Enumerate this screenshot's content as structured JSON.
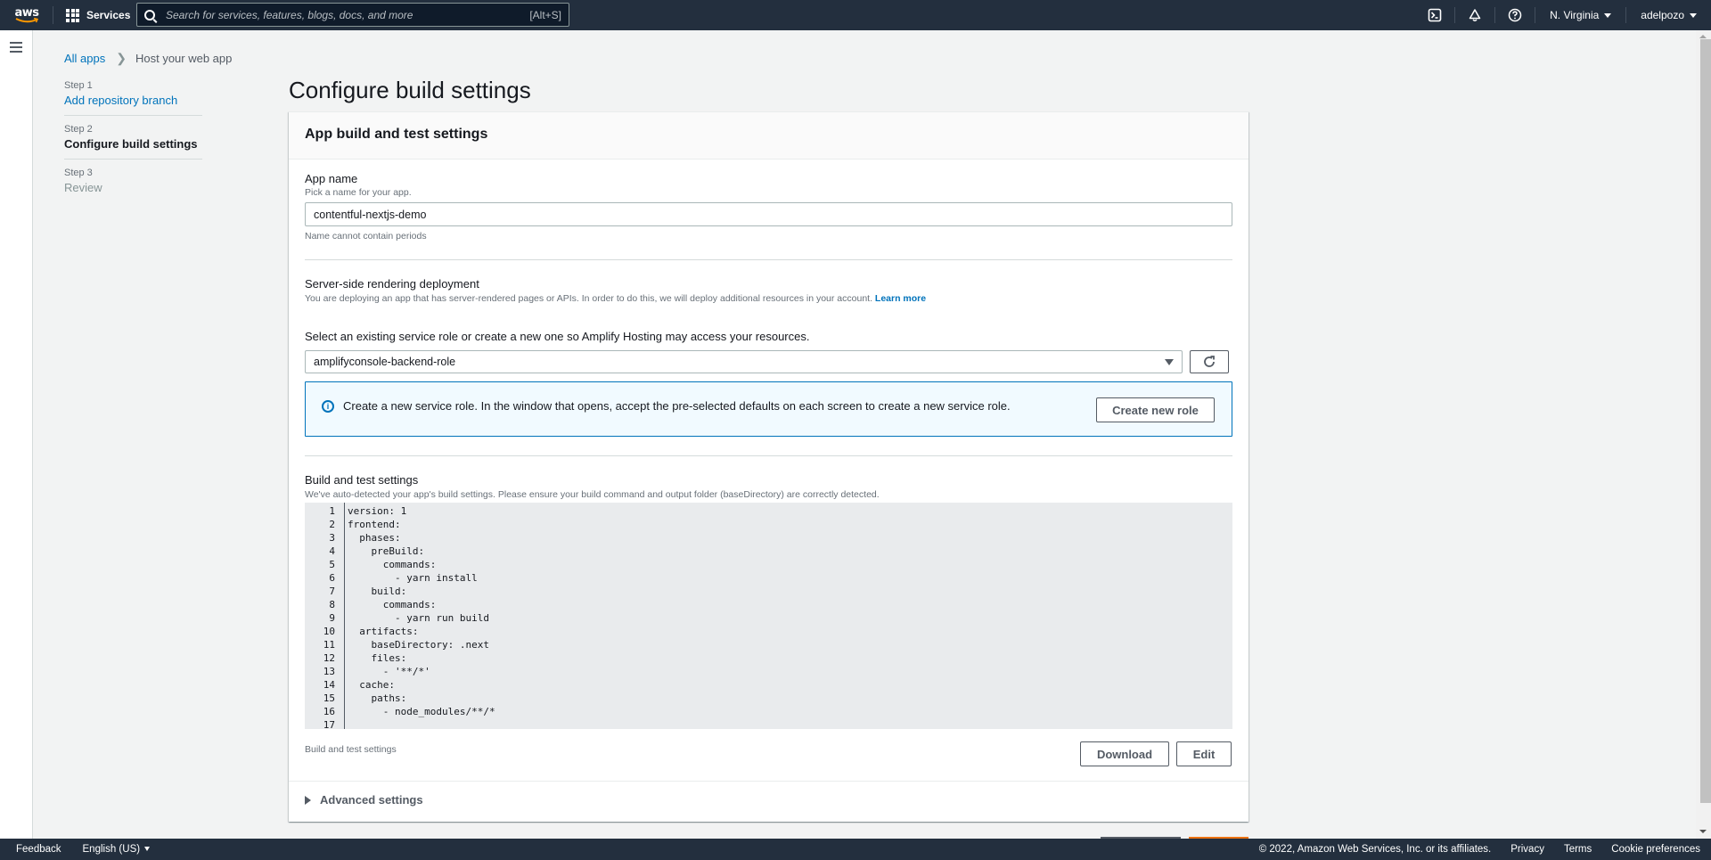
{
  "topnav": {
    "logo_text": "aws",
    "services_label": "Services",
    "search_placeholder": "Search for services, features, blogs, docs, and more",
    "search_shortcut": "[Alt+S]",
    "icons": [
      "cloudshell-icon",
      "bell-icon",
      "help-icon"
    ],
    "region": "N. Virginia",
    "user": "adelpozo"
  },
  "breadcrumb": {
    "items": [
      {
        "label": "All apps",
        "link": true
      },
      {
        "label": "Host your web app",
        "link": false
      }
    ]
  },
  "steps": [
    {
      "number": "Step 1",
      "label": "Add repository branch",
      "state": "completed"
    },
    {
      "number": "Step 2",
      "label": "Configure build settings",
      "state": "active"
    },
    {
      "number": "Step 3",
      "label": "Review",
      "state": "disabled"
    }
  ],
  "page": {
    "title": "Configure build settings"
  },
  "panel": {
    "title": "App build and test settings",
    "app_name": {
      "label": "App name",
      "description": "Pick a name for your app.",
      "value": "contentful-nextjs-demo",
      "constraint": "Name cannot contain periods"
    },
    "ssr": {
      "label": "Server-side rendering deployment",
      "description": "You are deploying an app that has server-rendered pages or APIs. In order to do this, we will deploy additional resources in your account.",
      "learn_more": "Learn more"
    },
    "service_role": {
      "label": "Select an existing service role or create a new one so Amplify Hosting may access your resources.",
      "selected": "amplifyconsole-backend-role",
      "refresh_icon": "refresh-icon"
    },
    "info": {
      "message": "Create a new service role. In the window that opens, accept the pre-selected defaults on each screen to create a new service role.",
      "button": "Create new role"
    },
    "build_settings": {
      "label": "Build and test settings",
      "description": "We've auto-detected your app's build settings. Please ensure your build command and output folder (baseDirectory) are correctly detected.",
      "code_lines": [
        "version: 1",
        "frontend:",
        "  phases:",
        "    preBuild:",
        "      commands:",
        "        - yarn install",
        "    build:",
        "      commands:",
        "        - yarn run build",
        "  artifacts:",
        "    baseDirectory: .next",
        "    files:",
        "      - '**/*'",
        "  cache:",
        "    paths:",
        "      - node_modules/**/*",
        ""
      ],
      "footer_label": "Build and test settings",
      "download_label": "Download",
      "edit_label": "Edit"
    },
    "advanced": {
      "label": "Advanced settings"
    }
  },
  "footer": {
    "feedback": "Feedback",
    "language": "English (US)",
    "copyright": "© 2022, Amazon Web Services, Inc. or its affiliates.",
    "links": [
      "Privacy",
      "Terms",
      "Cookie preferences"
    ]
  },
  "colors": {
    "nav_bg": "#232f3e",
    "link": "#0073bb",
    "primary": "#ec7211",
    "info_bg": "#f1faff"
  }
}
